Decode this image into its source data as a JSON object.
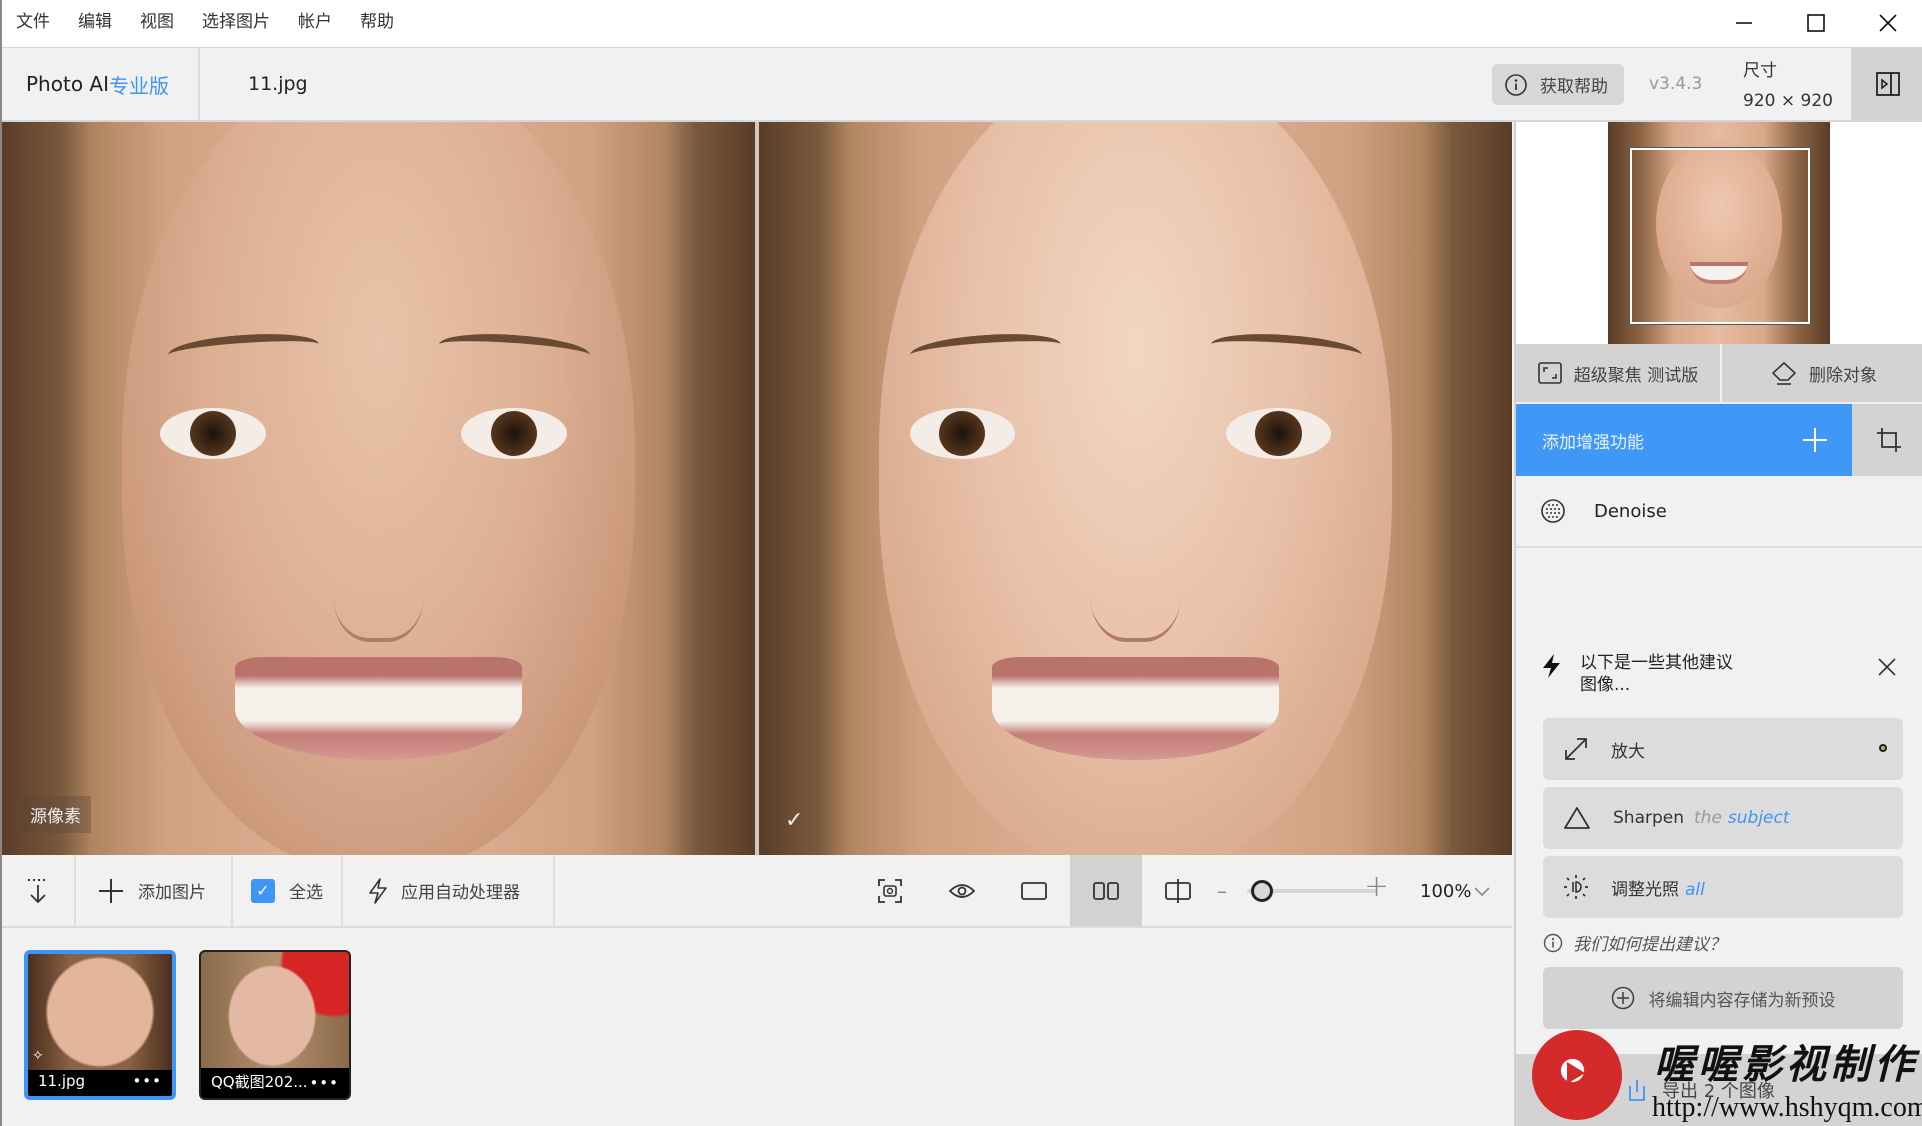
{
  "menu": [
    "文件",
    "编辑",
    "视图",
    "选择图片",
    "帐户",
    "帮助"
  ],
  "header": {
    "brand_name": "Photo AI",
    "brand_edition": "专业版",
    "filename": "11.jpg",
    "help_label": "获取帮助",
    "version": "v3.4.3",
    "dims_label": "尺寸",
    "dims_value": "920 × 920"
  },
  "views": {
    "left_label": "源像素",
    "right_status": "✓"
  },
  "toolbar": {
    "add_image_label": "添加图片",
    "select_all_label": "全选",
    "select_all_checked": true,
    "autopilot_label": "应用自动处理器",
    "view_modes": [
      "screenshot-icon",
      "eye-icon",
      "single-view-icon",
      "side-by-side-icon",
      "split-view-icon"
    ],
    "active_view_mode": "side-by-side-icon",
    "zoom_percent": "100%",
    "zoom_slider_fraction": 0.1
  },
  "thumbnails": [
    {
      "name": "11.jpg",
      "selected": true
    },
    {
      "name": "QQ截图202...",
      "selected": false
    }
  ],
  "panel": {
    "tools": [
      {
        "icon": "focus-icon",
        "label": "超级聚焦 测试版"
      },
      {
        "icon": "eraser-icon",
        "label": "删除对象"
      }
    ],
    "add_enhancement_label": "添加增强功能",
    "enhancements": [
      {
        "icon": "denoise-icon",
        "label": "Denoise"
      }
    ],
    "suggestions_title_line1": "以下是一些其他建议",
    "suggestions_title_line2": "图像...",
    "suggestions": [
      {
        "icon": "upscale-icon",
        "label": "放大",
        "muted": "",
        "highlight": "",
        "has_dot": true
      },
      {
        "icon": "sharpen-icon",
        "label": "Sharpen",
        "muted": "the",
        "highlight": "subject",
        "has_dot": false
      },
      {
        "icon": "lighting-icon",
        "label": "调整光照",
        "muted": "",
        "highlight": "all",
        "has_dot": false
      }
    ],
    "how_label": "我们如何提出建议？",
    "save_preset_label": "将编辑内容存储为新预设",
    "export_label": "导出 2 个图像"
  },
  "watermark": {
    "title": "喔喔影视制作",
    "url": "http://www.hshyqm.com/"
  },
  "colors": {
    "accent": "#3f97f6",
    "panel_gray": "#d3d3d3",
    "background": "#f1f1f1"
  }
}
